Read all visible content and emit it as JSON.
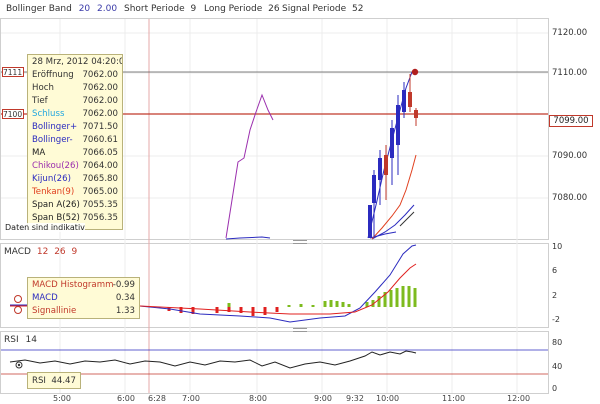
{
  "toolbar": {
    "bollinger": {
      "label": "Bollinger Band",
      "period": "20",
      "dev": "2.00"
    },
    "macd_params": {
      "short_label": "Short Periode",
      "short_val": "9",
      "long_label": "Long Periode",
      "long_val": "26",
      "signal_label": "Signal Periode",
      "signal_val": "52"
    }
  },
  "tooltip": {
    "date": "28 Mrz, 2012 04:20:00",
    "rows": [
      {
        "label": "Eröffnung",
        "value": "7062.00",
        "color": "#333333"
      },
      {
        "label": "Hoch",
        "value": "7062.00",
        "color": "#333333"
      },
      {
        "label": "Tief",
        "value": "7062.00",
        "color": "#333333"
      },
      {
        "label": "Schluss",
        "value": "7062.00",
        "color": "#22a7e0"
      },
      {
        "label": "Bollinger+",
        "value": "7071.50",
        "color": "#2b2bbf"
      },
      {
        "label": "Bollinger-",
        "value": "7060.61",
        "color": "#2b2bbf"
      },
      {
        "label": "MA",
        "value": "7066.05",
        "color": "#222222"
      },
      {
        "label": "Chikou(26)",
        "value": "7064.00",
        "color": "#9b2fae"
      },
      {
        "label": "Kijun(26)",
        "value": "7065.80",
        "color": "#2b2bbf"
      },
      {
        "label": "Tenkan(9)",
        "value": "7065.00",
        "color": "#e0401f"
      },
      {
        "label": "Span A(26)",
        "value": "7055.35",
        "color": "#222222"
      },
      {
        "label": "Span B(52)",
        "value": "7056.35",
        "color": "#222222"
      }
    ]
  },
  "note": "Daten sind indikativ",
  "left_marks": {
    "upper": "7111",
    "lower": "7100"
  },
  "price_axis": {
    "labels": [
      "7120.00",
      "7110.00",
      "7090.00",
      "7080.00"
    ],
    "current": "7099.00"
  },
  "macd": {
    "title": "MACD",
    "params": [
      "12",
      "26",
      "9"
    ],
    "tooltip": {
      "hist_label": "MACD Histogramm",
      "hist_value": "-0.99",
      "macd_label": "MACD",
      "macd_value": "0.34",
      "signal_label": "Signallinie",
      "signal_value": "1.33"
    },
    "axis": [
      "10",
      "6",
      "2",
      "-2"
    ]
  },
  "rsi": {
    "title": "RSI",
    "period": "14",
    "tooltip_label": "RSI",
    "tooltip_value": "44.47",
    "axis": [
      "80",
      "40",
      "0"
    ]
  },
  "time_axis": [
    "5:00",
    "6:00",
    "6:28",
    "7:00",
    "8:00",
    "9:00",
    "9:32",
    "10:00",
    "11:00",
    "12:00"
  ],
  "colors": {
    "candle_up": "#2b2bbf",
    "candle_down": "#c0392b",
    "hist_pos": "#7dbb1e",
    "hist_neg": "#e0201f"
  }
}
